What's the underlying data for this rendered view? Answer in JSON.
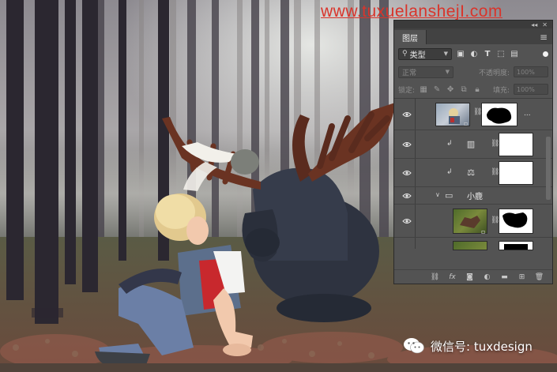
{
  "watermark": "www.tuxuelanshejI.com",
  "wechat": {
    "label": "微信号: tuxdesign",
    "icon": "wechat-icon"
  },
  "panel": {
    "tab": "图层",
    "filter_kind": "类型",
    "blend_mode": "正常",
    "opacity_label": "不透明度:",
    "opacity_value": "100%",
    "lock_label": "锁定:",
    "fill_label": "填充:",
    "fill_value": "100%",
    "group_name": "小鹿",
    "layer_more": "...",
    "icons": {
      "filter": [
        "image-filter-icon",
        "adjustment-filter-icon",
        "type-filter-icon",
        "shape-filter-icon",
        "smartobject-filter-icon"
      ],
      "lock": [
        "lock-transparent-icon",
        "lock-paint-icon",
        "lock-move-icon",
        "lock-artboard-icon",
        "lock-all-icon"
      ],
      "bottom": [
        "link-layers-icon",
        "fx-icon",
        "add-mask-icon",
        "new-adjustment-icon",
        "new-group-icon",
        "new-layer-icon",
        "delete-layer-icon"
      ]
    }
  },
  "colors": {
    "panel_bg": "#535353",
    "watermark": "#d9342b"
  }
}
